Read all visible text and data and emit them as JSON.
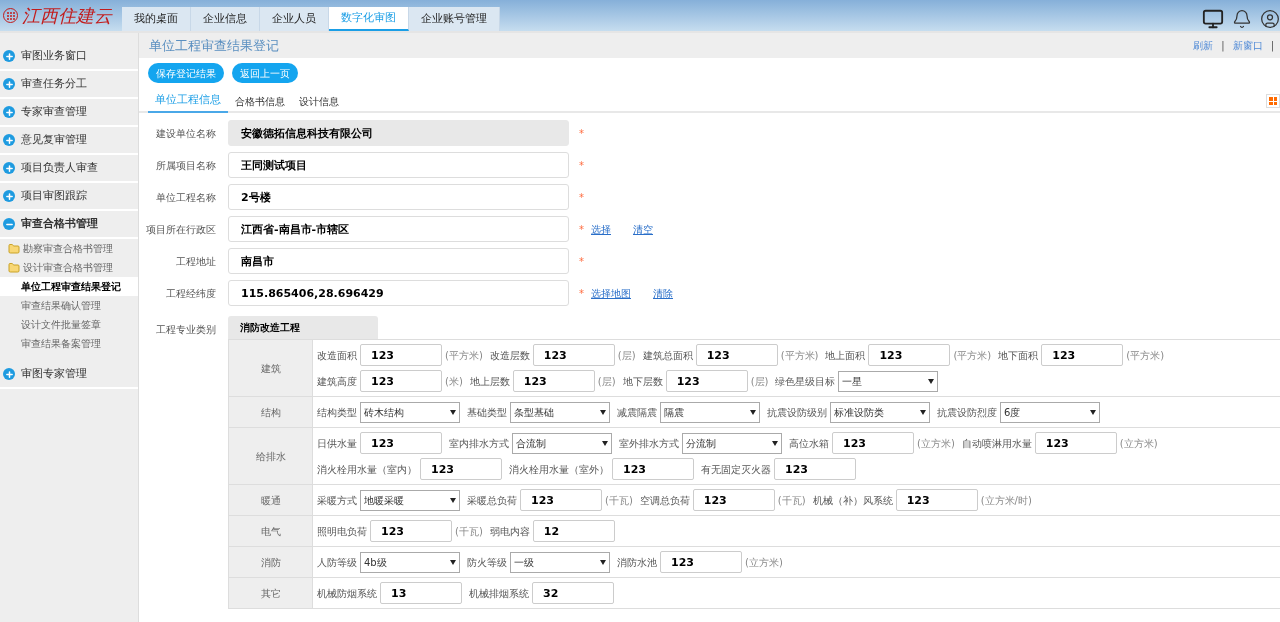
{
  "header": {
    "logo": "江西住建云",
    "nav": [
      {
        "label": "我的桌面",
        "selected": false
      },
      {
        "label": "企业信息",
        "selected": false
      },
      {
        "label": "企业人员",
        "selected": false
      },
      {
        "label": "数字化审图",
        "selected": true
      },
      {
        "label": "企业账号管理",
        "selected": false
      }
    ]
  },
  "sidebar": {
    "items": [
      {
        "label": "审图业务窗口",
        "expanded": false
      },
      {
        "label": "审查任务分工",
        "expanded": false
      },
      {
        "label": "专家审查管理",
        "expanded": false
      },
      {
        "label": "意见复审管理",
        "expanded": false
      },
      {
        "label": "项目负责人审查",
        "expanded": false
      },
      {
        "label": "项目审图跟踪",
        "expanded": false
      },
      {
        "label": "审查合格书管理",
        "expanded": true,
        "children": [
          {
            "label": "勘察审查合格书管理",
            "kind": "folder",
            "selected": false
          },
          {
            "label": "设计审查合格书管理",
            "kind": "folder",
            "selected": false
          },
          {
            "label": "单位工程审查结果登记",
            "kind": "page",
            "selected": true
          },
          {
            "label": "审查结果确认管理",
            "kind": "page",
            "selected": false
          },
          {
            "label": "设计文件批量签章",
            "kind": "page",
            "selected": false
          },
          {
            "label": "审查结果备案管理",
            "kind": "page",
            "selected": false
          }
        ]
      },
      {
        "label": "审图专家管理",
        "expanded": false
      }
    ]
  },
  "page": {
    "title": "单位工程审查结果登记",
    "top_links": [
      {
        "kind": "link",
        "text": "刷新"
      },
      {
        "kind": "separator",
        "text": "|"
      },
      {
        "kind": "link",
        "text": "新窗口"
      },
      {
        "kind": "separator",
        "text": "|"
      }
    ],
    "required_mark": "*",
    "buttons": [
      "保存登记结果",
      "返回上一页"
    ],
    "tabs": [
      {
        "label": "单位工程信息",
        "selected": true
      },
      {
        "label": "合格书信息",
        "selected": false
      },
      {
        "label": "设计信息",
        "selected": false
      }
    ],
    "fields": [
      {
        "label": "建设单位名称",
        "value": "安徽德拓信息科技有限公司",
        "readonly": true,
        "required": true
      },
      {
        "label": "所属项目名称",
        "value": "王同测试项目",
        "readonly": false,
        "required": true
      },
      {
        "label": "单位工程名称",
        "value": "2号楼",
        "readonly": false,
        "required": true
      },
      {
        "label": "项目所在行政区",
        "value": "江西省-南昌市-市辖区",
        "readonly": false,
        "required": true,
        "links": [
          "选择",
          "清空"
        ]
      },
      {
        "label": "工程地址",
        "value": "南昌市",
        "readonly": false,
        "required": true
      },
      {
        "label": "工程经纬度",
        "value": "115.865406,28.696429",
        "readonly": false,
        "required": true,
        "links": [
          "选择地图",
          "清除"
        ]
      }
    ],
    "specialty": {
      "label": "工程专业类别",
      "value": "消防改造工程",
      "rows": [
        {
          "category": "建筑",
          "lines": [
            [
              {
                "kind": "input",
                "label": "改造面积",
                "value": "123",
                "unit": "(平方米)"
              },
              {
                "kind": "input",
                "label": "改造层数",
                "value": "123",
                "unit": "(层)"
              },
              {
                "kind": "input",
                "label": "建筑总面积",
                "value": "123",
                "unit": "(平方米)"
              },
              {
                "kind": "input",
                "label": "地上面积",
                "value": "123",
                "unit": "(平方米)"
              },
              {
                "kind": "input",
                "label": "地下面积",
                "value": "123",
                "unit": "(平方米)"
              }
            ],
            [
              {
                "kind": "input",
                "label": "建筑高度",
                "value": "123",
                "unit": "(米)"
              },
              {
                "kind": "input",
                "label": "地上层数",
                "value": "123",
                "unit": "(层)"
              },
              {
                "kind": "input",
                "label": "地下层数",
                "value": "123",
                "unit": "(层)"
              },
              {
                "kind": "select",
                "label": "绿色星级目标",
                "value": "一星"
              }
            ]
          ]
        },
        {
          "category": "结构",
          "lines": [
            [
              {
                "kind": "select",
                "label": "结构类型",
                "value": "砖木结构"
              },
              {
                "kind": "select",
                "label": "基础类型",
                "value": "条型基础"
              },
              {
                "kind": "select",
                "label": "减震隔震",
                "value": "隔震"
              },
              {
                "kind": "select",
                "label": "抗震设防级别",
                "value": "标准设防类"
              },
              {
                "kind": "select",
                "label": "抗震设防烈度",
                "value": "6度"
              }
            ]
          ]
        },
        {
          "category": "给排水",
          "lines": [
            [
              {
                "kind": "input",
                "label": "日供水量",
                "value": "123"
              },
              {
                "kind": "select",
                "label": "室内排水方式",
                "value": "合流制"
              },
              {
                "kind": "select",
                "label": "室外排水方式",
                "value": "分流制"
              },
              {
                "kind": "input",
                "label": "高位水箱",
                "value": "123",
                "unit": "(立方米)"
              },
              {
                "kind": "input",
                "label": "自动喷淋用水量",
                "value": "123",
                "unit": "(立方米)"
              }
            ],
            [
              {
                "kind": "input",
                "label": "消火栓用水量（室内）",
                "value": "123"
              },
              {
                "kind": "input",
                "label": "消火栓用水量（室外）",
                "value": "123"
              },
              {
                "kind": "input",
                "label": "有无固定灭火器",
                "value": "123"
              }
            ]
          ]
        },
        {
          "category": "暖通",
          "lines": [
            [
              {
                "kind": "select",
                "label": "采暖方式",
                "value": "地暖采暖"
              },
              {
                "kind": "input",
                "label": "采暖总负荷",
                "value": "123",
                "unit": "(千瓦)"
              },
              {
                "kind": "input",
                "label": "空调总负荷",
                "value": "123",
                "unit": "(千瓦)"
              },
              {
                "kind": "input",
                "label": "机械（补）风系统",
                "value": "123",
                "unit": "(立方米/时)"
              }
            ]
          ]
        },
        {
          "category": "电气",
          "lines": [
            [
              {
                "kind": "input",
                "label": "照明电负荷",
                "value": "123",
                "unit": "(千瓦)"
              },
              {
                "kind": "input",
                "label": "弱电内容",
                "value": "12"
              }
            ]
          ]
        },
        {
          "category": "消防",
          "lines": [
            [
              {
                "kind": "select",
                "label": "人防等级",
                "value": "4b级"
              },
              {
                "kind": "select",
                "label": "防火等级",
                "value": "一级"
              },
              {
                "kind": "input",
                "label": "消防水池",
                "value": "123",
                "unit": "(立方米)"
              }
            ]
          ]
        },
        {
          "category": "其它",
          "lines": [
            [
              {
                "kind": "input",
                "label": "机械防烟系统",
                "value": "13"
              },
              {
                "kind": "input",
                "label": "机械排烟系统",
                "value": "32"
              }
            ]
          ]
        }
      ]
    }
  }
}
